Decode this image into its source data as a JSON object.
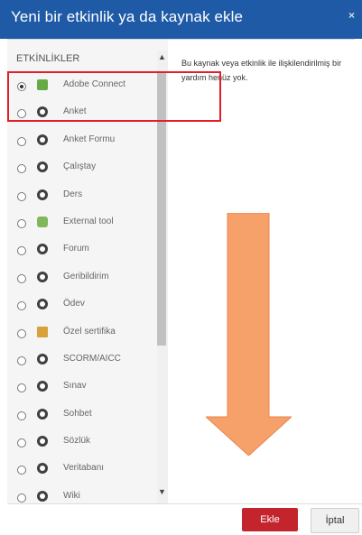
{
  "header": {
    "title": "Yeni bir etkinlik ya da kaynak ekle",
    "close_symbol": "×"
  },
  "left": {
    "section_title": "ETKİNLİKLER",
    "items": [
      {
        "label": "Adobe Connect",
        "checked": true,
        "icon": "adobe-connect-icon"
      },
      {
        "label": "Anket",
        "checked": false,
        "icon": "survey-icon"
      },
      {
        "label": "Anket Formu",
        "checked": false,
        "icon": "form-icon"
      },
      {
        "label": "Çalıştay",
        "checked": false,
        "icon": "workshop-icon"
      },
      {
        "label": "Ders",
        "checked": false,
        "icon": "lesson-icon"
      },
      {
        "label": "External tool",
        "checked": false,
        "icon": "puzzle-icon"
      },
      {
        "label": "Forum",
        "checked": false,
        "icon": "forum-icon"
      },
      {
        "label": "Geribildirim",
        "checked": false,
        "icon": "feedback-icon"
      },
      {
        "label": "Ödev",
        "checked": false,
        "icon": "assignment-icon"
      },
      {
        "label": "Özel sertifika",
        "checked": false,
        "icon": "certificate-icon"
      },
      {
        "label": "SCORM/AICC",
        "checked": false,
        "icon": "scorm-icon"
      },
      {
        "label": "Sınav",
        "checked": false,
        "icon": "quiz-icon"
      },
      {
        "label": "Sohbet",
        "checked": false,
        "icon": "chat-icon"
      },
      {
        "label": "Sözlük",
        "checked": false,
        "icon": "glossary-icon"
      },
      {
        "label": "Veritabanı",
        "checked": false,
        "icon": "database-icon"
      },
      {
        "label": "Wiki",
        "checked": false,
        "icon": "wiki-icon"
      }
    ]
  },
  "help": {
    "text": "Bu kaynak veya etkinlik ile ilişkilendirilmiş bir yardım henüz yok."
  },
  "footer": {
    "add_label": "Ekle",
    "cancel_label": "İptal"
  },
  "colors": {
    "header": "#1f5aa6",
    "highlight": "#e21f26",
    "arrow": "#f6a06a",
    "primary_button": "#c4242c"
  }
}
